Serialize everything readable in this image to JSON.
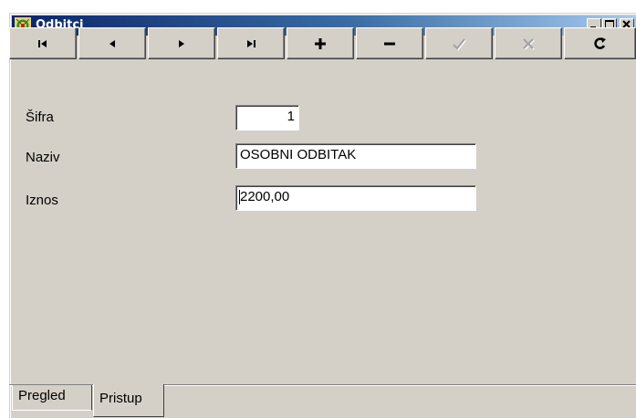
{
  "window": {
    "title": "Odbitci"
  },
  "caption_buttons": [
    "minimize-icon",
    "maximize-icon",
    "close-icon"
  ],
  "toolbar": {
    "buttons": [
      {
        "name": "first-record-button",
        "icon": "first-icon",
        "enabled": true
      },
      {
        "name": "prior-record-button",
        "icon": "prior-icon",
        "enabled": true
      },
      {
        "name": "next-record-button",
        "icon": "next-icon",
        "enabled": true
      },
      {
        "name": "last-record-button",
        "icon": "last-icon",
        "enabled": true
      },
      {
        "name": "insert-record-button",
        "icon": "plus-icon",
        "enabled": true
      },
      {
        "name": "delete-record-button",
        "icon": "minus-icon",
        "enabled": true
      },
      {
        "name": "post-edit-button",
        "icon": "check-icon",
        "enabled": false
      },
      {
        "name": "cancel-edit-button",
        "icon": "cancel-icon",
        "enabled": false
      },
      {
        "name": "refresh-data-button",
        "icon": "refresh-icon",
        "enabled": true
      }
    ]
  },
  "form": {
    "sifra_label": "Šifra",
    "sifra_value": "1",
    "naziv_label": "Naziv",
    "naziv_value": "OSOBNI ODBITAK",
    "iznos_label": "Iznos",
    "iznos_value": "2200,00"
  },
  "tabs": {
    "pregled": "Pregled",
    "pristup": "Pristup",
    "active": "Pristup"
  },
  "colors": {
    "face": "#d4d0c8",
    "title_start": "#0a246a",
    "title_end": "#a6caf0",
    "disabled_icon": "#a0a0a0"
  }
}
